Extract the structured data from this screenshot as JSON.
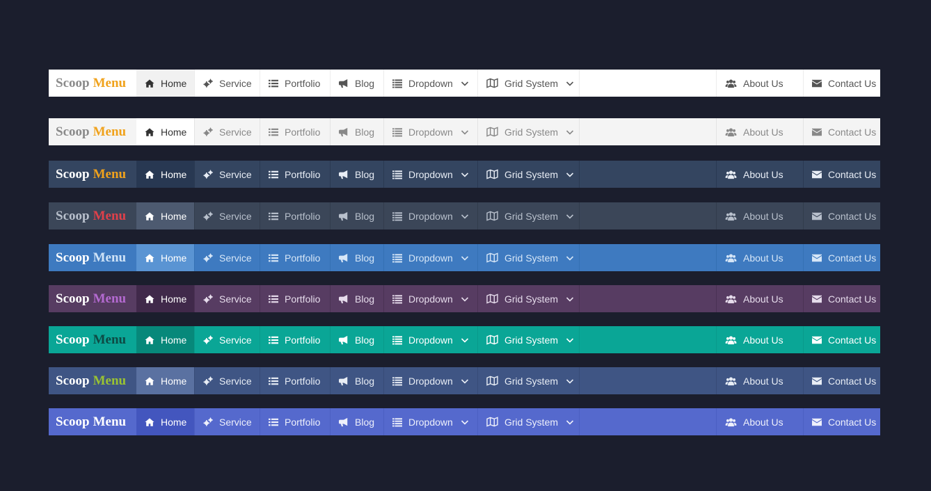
{
  "menu": {
    "brand_part1": "Scoop",
    "brand_part2": "Menu",
    "items_left": [
      {
        "label": "Home",
        "icon": "home-icon"
      },
      {
        "label": "Service",
        "icon": "cogs-icon"
      },
      {
        "label": "Portfolio",
        "icon": "list-icon"
      },
      {
        "label": "Blog",
        "icon": "bullhorn-icon"
      },
      {
        "label": "Dropdown",
        "icon": "list-alt-icon",
        "has_chevron": true
      },
      {
        "label": "Grid System",
        "icon": "map-icon",
        "has_chevron": true
      }
    ],
    "items_right": [
      {
        "label": "About Us",
        "icon": "users-icon"
      },
      {
        "label": "Contact Us",
        "icon": "envelope-icon"
      }
    ]
  },
  "themes": [
    {
      "name": "white",
      "bg": "#ffffff",
      "fg": "#555555",
      "brand1": "#8a8a8a",
      "brand2": "#f0a21c",
      "active_bg": "#f1f1f1",
      "active_fg": "#333333",
      "separator": "#ececec"
    },
    {
      "name": "light-gray",
      "bg": "#f4f4f4",
      "fg": "#888888",
      "brand1": "#8a8a8a",
      "brand2": "#f0a21c",
      "active_bg": "#ffffff",
      "active_fg": "#333333",
      "separator": "#e3e3e3"
    },
    {
      "name": "slate-dark",
      "bg": "#344560",
      "fg": "#e8edf5",
      "brand1": "#ffffff",
      "brand2": "#f0a21c",
      "active_bg": "#283852",
      "active_fg": "#ffffff",
      "separator": "#2a3952"
    },
    {
      "name": "slate-gray",
      "bg": "#3b4658",
      "fg": "#b8c0cc",
      "brand1": "#b8c0cc",
      "brand2": "#e0404a",
      "active_bg": "#4d5a70",
      "active_fg": "#ffffff",
      "separator": "#323c4c"
    },
    {
      "name": "blue",
      "bg": "#3e7ac0",
      "fg": "#d6e6f7",
      "brand1": "#ffffff",
      "brand2": "#cfe3f7",
      "active_bg": "#5a94d3",
      "active_fg": "#ffffff",
      "separator": "#3470b3"
    },
    {
      "name": "purple",
      "bg": "#573c62",
      "fg": "#e6dcec",
      "brand1": "#ffffff",
      "brand2": "#b46ad1",
      "active_bg": "#40294a",
      "active_fg": "#ffffff",
      "separator": "#4a3254"
    },
    {
      "name": "teal",
      "bg": "#0aa696",
      "fg": "#ffffff",
      "brand1": "#ffffff",
      "brand2": "#0d4a44",
      "active_bg": "#07887a",
      "active_fg": "#ffffff",
      "separator": "#099a8b"
    },
    {
      "name": "navy",
      "bg": "#3f5584",
      "fg": "#e8edf5",
      "brand1": "#ffffff",
      "brand2": "#9ac332",
      "active_bg": "#5a71a1",
      "active_fg": "#ffffff",
      "separator": "#374b77"
    },
    {
      "name": "indigo",
      "bg": "#5569cd",
      "fg": "#eef0fb",
      "brand1": "#ffffff",
      "brand2": "#ffffff",
      "active_bg": "#4356be",
      "active_fg": "#ffffff",
      "separator": "#4b5fc2"
    }
  ]
}
